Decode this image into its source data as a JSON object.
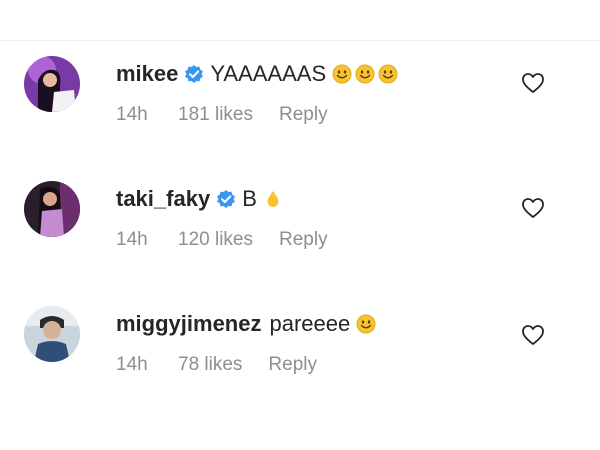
{
  "comments": [
    {
      "username": "mikee",
      "verified": true,
      "text": "YAAAAAAS",
      "emoji": [
        "smiling-face-icon",
        "smiling-face-icon",
        "smiling-face-icon"
      ],
      "time": "14h",
      "likes": "181 likes",
      "reply": "Reply"
    },
    {
      "username": "taki_faky",
      "verified": true,
      "text": "B",
      "emoji": [
        "droplet-icon"
      ],
      "time": "14h",
      "likes": "120 likes",
      "reply": "Reply"
    },
    {
      "username": "miggyjimenez",
      "verified": false,
      "text": "pareeee",
      "emoji": [
        "smiling-face-icon"
      ],
      "time": "14h",
      "likes": "78 likes",
      "reply": "Reply"
    }
  ],
  "colors": {
    "primary_text": "#262626",
    "secondary_text": "#8e8e8e",
    "verified_blue": "#3897f0",
    "emoji_yellow": "#f7c331",
    "divider": "#efefef"
  }
}
